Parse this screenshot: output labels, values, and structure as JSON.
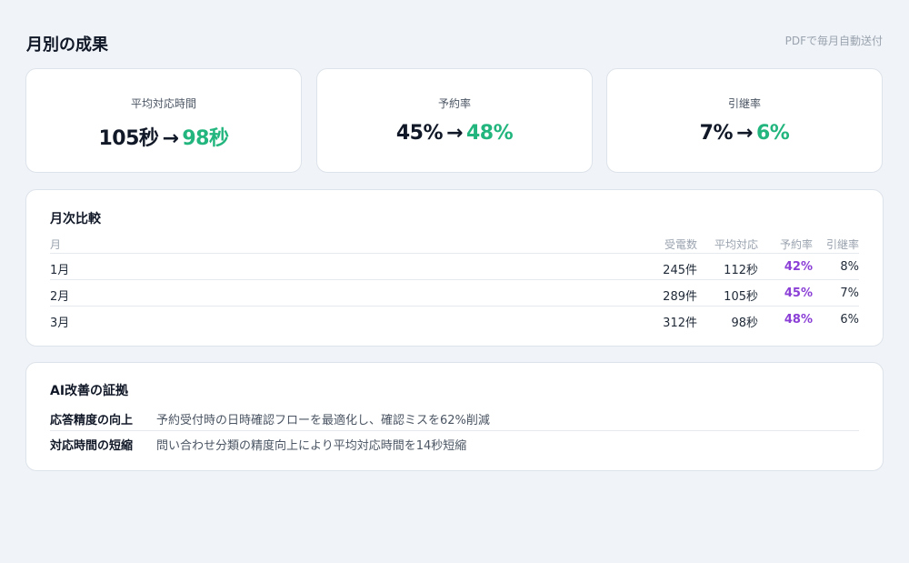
{
  "header": {
    "title": "月別の成果",
    "note": "PDFで毎月自動送付"
  },
  "stats": [
    {
      "label": "平均対応時間",
      "before": "105秒",
      "arrow": "→",
      "after": "98秒"
    },
    {
      "label": "予約率",
      "before": "45%",
      "arrow": "→",
      "after": "48%"
    },
    {
      "label": "引継率",
      "before": "7%",
      "arrow": "→",
      "after": "6%"
    }
  ],
  "monthly": {
    "title": "月次比較",
    "columns": [
      "月",
      "受電数",
      "平均対応",
      "予約率",
      "引継率"
    ],
    "rows": [
      [
        "1月",
        "245件",
        "112秒",
        "42%",
        "8%"
      ],
      [
        "2月",
        "289件",
        "105秒",
        "45%",
        "7%"
      ],
      [
        "3月",
        "312件",
        "98秒",
        "48%",
        "6%"
      ]
    ]
  },
  "evidence": {
    "title": "AI改善の証拠",
    "items": [
      {
        "label": "応答精度の向上",
        "text": "予約受付時の日時確認フローを最適化し、確認ミスを62%削減"
      },
      {
        "label": "対応時間の短縮",
        "text": "問い合わせ分類の精度向上により平均対応時間を14秒短縮"
      }
    ]
  },
  "colors": {
    "improved": "#22b57e",
    "rate_highlight": "#8b3fd6",
    "background": "#f0f3f7"
  }
}
